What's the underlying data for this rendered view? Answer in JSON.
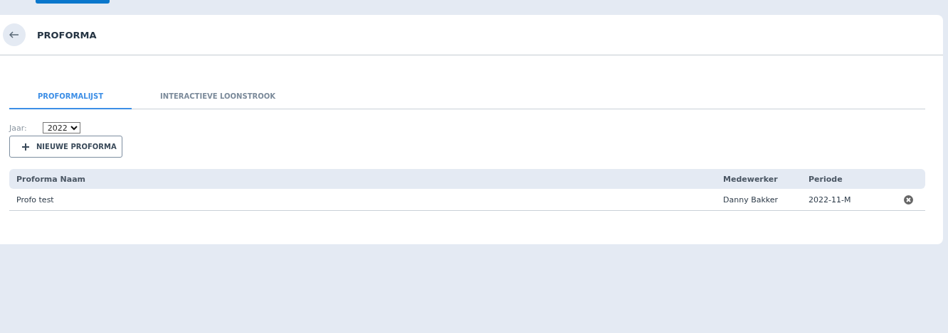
{
  "header": {
    "title": "PROFORMA"
  },
  "tabs": [
    {
      "label": "PROFORMALIJST",
      "selected": true
    },
    {
      "label": "INTERACTIEVE LOONSTROOK",
      "selected": false
    }
  ],
  "year_filter": {
    "label": "Jaar:",
    "value": "2022"
  },
  "new_button": {
    "label": "NIEUWE PROFORMA"
  },
  "table": {
    "columns": [
      "Proforma Naam",
      "Medewerker",
      "Periode"
    ],
    "rows": [
      {
        "cells": [
          "Profo test",
          "Danny Bakker",
          "2022-11-M"
        ]
      }
    ]
  }
}
